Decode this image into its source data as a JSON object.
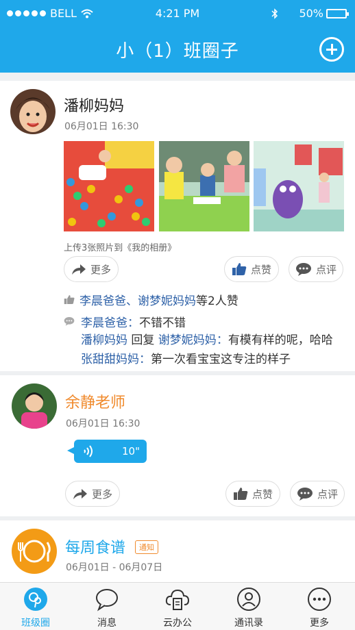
{
  "status_bar": {
    "carrier": "BELL",
    "time": "4:21 PM",
    "battery": "50%",
    "battery_level": 0.5
  },
  "nav": {
    "title": "小（1）班圈子"
  },
  "actions": {
    "more": "更多",
    "like": "点赞",
    "comment": "点评"
  },
  "post1": {
    "name": "潘柳妈妈",
    "time": "06月01日  16:30",
    "caption": "上传3张照片到《我的相册》",
    "likes_names": "李晨爸爸、谢梦妮妈妈",
    "likes_suffix": "等2人赞",
    "comments": [
      {
        "from": "李晨爸爸",
        "sep": "：",
        "text": "不错不错"
      },
      {
        "from": "潘柳妈妈",
        "mid": " 回复 ",
        "to": "谢梦妮妈妈",
        "sep": "：",
        "text": "有模有样的呢，哈哈"
      },
      {
        "from": "张甜甜妈妈",
        "sep": "：",
        "text": "第一次看宝宝这专注的样子"
      }
    ]
  },
  "post2": {
    "name": "余静老师",
    "time": "06月01日  16:30",
    "voice_duration": "10\""
  },
  "post3": {
    "name": "每周食谱",
    "tag": "通知",
    "date_range": "06月01日  -  06月07日"
  },
  "tabs": [
    {
      "label": "班级圈",
      "icon": "class-circle-icon",
      "active": true
    },
    {
      "label": "消息",
      "icon": "message-icon"
    },
    {
      "label": "云办公",
      "icon": "cloud-office-icon"
    },
    {
      "label": "通讯录",
      "icon": "contacts-icon"
    },
    {
      "label": "更多",
      "icon": "more-icon"
    }
  ],
  "colors": {
    "primary": "#1fa8ea",
    "link": "#2f62a8",
    "teacher": "#f08a2c",
    "menu": "#23a6e4"
  }
}
